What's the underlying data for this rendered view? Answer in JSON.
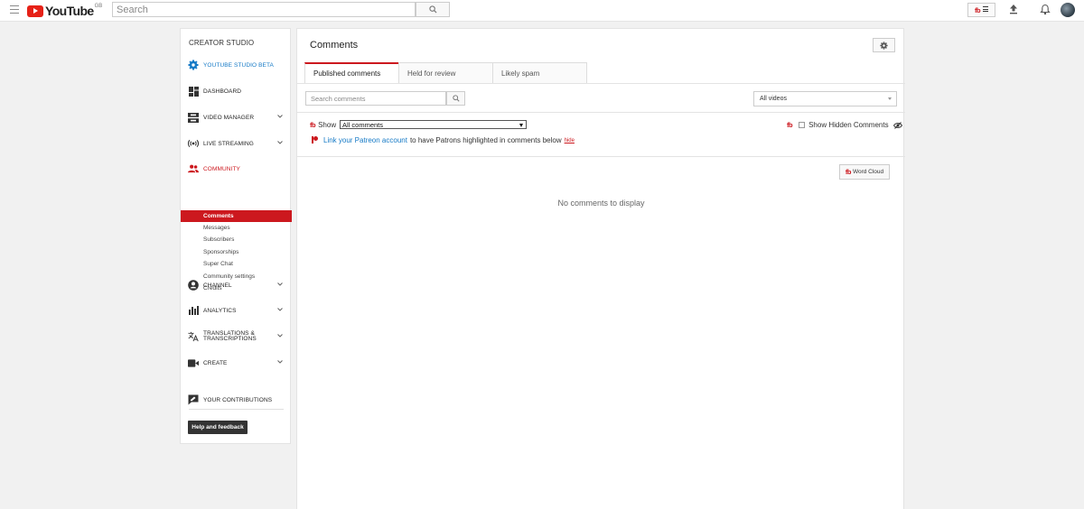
{
  "topbar": {
    "logo_word": "YouTube",
    "logo_region": "GB",
    "search_placeholder": "Search"
  },
  "sidebar": {
    "title": "CREATOR STUDIO",
    "items": [
      {
        "label": "YOUTUBE STUDIO BETA",
        "icon": "gear-icon"
      },
      {
        "label": "DASHBOARD",
        "icon": "dashboard-icon"
      },
      {
        "label": "VIDEO MANAGER",
        "icon": "video-manager-icon"
      },
      {
        "label": "LIVE STREAMING",
        "icon": "live-streaming-icon"
      },
      {
        "label": "COMMUNITY",
        "icon": "community-icon"
      },
      {
        "label": "CHANNEL",
        "icon": "channel-icon"
      },
      {
        "label": "ANALYTICS",
        "icon": "analytics-icon"
      },
      {
        "label": "TRANSLATIONS & TRANSCRIPTIONS",
        "icon": "translate-icon"
      },
      {
        "label": "CREATE",
        "icon": "create-icon"
      },
      {
        "label": "YOUR CONTRIBUTIONS",
        "icon": "contributions-icon"
      }
    ],
    "community_sub": [
      "Comments",
      "Messages",
      "Subscribers",
      "Sponsorships",
      "Super Chat",
      "Community settings",
      "Credits"
    ],
    "active_sub": "Comments",
    "help_button": "Help and feedback"
  },
  "main": {
    "title": "Comments",
    "tabs": [
      "Published comments",
      "Held for review",
      "Likely spam"
    ],
    "active_tab": "Published comments",
    "search_placeholder": "Search comments",
    "videos_filter": "All videos",
    "show_label": "Show",
    "show_value": "All comments",
    "hidden_label": "Show Hidden Comments",
    "patreon_link": "Link your Patreon account",
    "patreon_text": "to have Patrons highlighted in comments below",
    "hide_link": "hide",
    "fb_badge": "fb",
    "word_cloud_button": "Word Cloud",
    "empty_message": "No comments to display"
  },
  "colors": {
    "brand_red": "#cc181e",
    "link_blue": "#167ac6",
    "dark_button": "#333333"
  }
}
